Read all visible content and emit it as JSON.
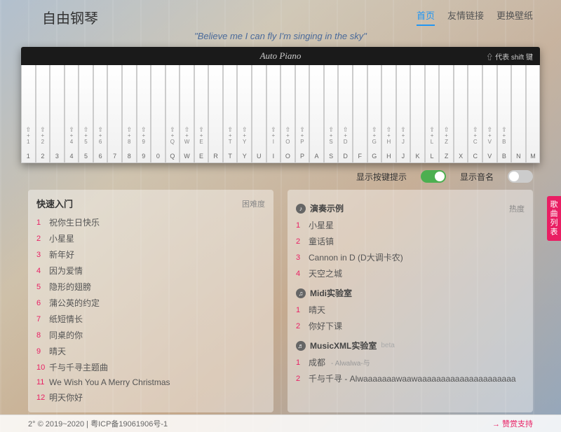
{
  "header": {
    "logo": "自由钢琴",
    "nav": [
      {
        "label": "首页",
        "active": true
      },
      {
        "label": "友情链接",
        "active": false
      },
      {
        "label": "更换壁纸",
        "active": false
      }
    ],
    "tagline": "\"Believe me I can fly I'm singing in the sky\""
  },
  "piano": {
    "brand": "Auto Piano",
    "hint": "⇧ 代表 shift 键",
    "white_keys": [
      "1",
      "2",
      "3",
      "4",
      "5",
      "6",
      "7",
      "8",
      "9",
      "0",
      "Q",
      "W",
      "E",
      "R",
      "T",
      "Y",
      "U",
      "I",
      "O",
      "P",
      "A",
      "S",
      "D",
      "F",
      "G",
      "H",
      "J",
      "K",
      "L",
      "Z",
      "X",
      "C",
      "V",
      "B",
      "N",
      "M"
    ],
    "shift_labels": [
      "1",
      "2",
      "",
      "4",
      "5",
      "6",
      "",
      "8",
      "9",
      "",
      "Q",
      "W",
      "E",
      "",
      "T",
      "Y",
      "",
      "I",
      "O",
      "P",
      "",
      "S",
      "D",
      "",
      "G",
      "H",
      "J",
      "",
      "L",
      "Z",
      "",
      "C",
      "V",
      "B",
      "",
      ""
    ]
  },
  "controls": {
    "show_keys": {
      "label": "显示按键提示",
      "on": true
    },
    "show_notes": {
      "label": "显示音名",
      "on": false
    }
  },
  "left_panel": {
    "title": "快速入门",
    "sub": "困难度",
    "songs": [
      {
        "n": "1",
        "t": "祝你生日快乐"
      },
      {
        "n": "2",
        "t": "小星星"
      },
      {
        "n": "3",
        "t": "新年好"
      },
      {
        "n": "4",
        "t": "因为爱情"
      },
      {
        "n": "5",
        "t": "隐形的翅膀"
      },
      {
        "n": "6",
        "t": "蒲公英的约定"
      },
      {
        "n": "7",
        "t": "纸短情长"
      },
      {
        "n": "8",
        "t": "同桌的你"
      },
      {
        "n": "9",
        "t": "晴天"
      },
      {
        "n": "10",
        "t": "千与千寻主题曲"
      },
      {
        "n": "11",
        "t": "We Wish You A Merry Christmas"
      },
      {
        "n": "12",
        "t": "明天你好"
      }
    ]
  },
  "right_panel": {
    "sections": [
      {
        "icon": "♪",
        "title": "演奏示例",
        "heat": "热度",
        "songs": [
          {
            "n": "1",
            "t": "小星星"
          },
          {
            "n": "2",
            "t": "童话镇"
          },
          {
            "n": "3",
            "t": "Cannon in D (D大调卡农)"
          },
          {
            "n": "4",
            "t": "天空之城"
          }
        ]
      },
      {
        "icon": "♫",
        "title": "Midi实验室",
        "songs": [
          {
            "n": "1",
            "t": "晴天"
          },
          {
            "n": "2",
            "t": "你好下课"
          }
        ]
      },
      {
        "icon": "♬",
        "title": "MusicXML实验室",
        "beta": "beta",
        "songs": [
          {
            "n": "1",
            "t": "成都",
            "extra": "- Alwalwa-与"
          },
          {
            "n": "2",
            "t": "千与千寻 - Alwaaaaaaawaawaaaaaaaaaaaaaaaaaaaaa"
          }
        ]
      }
    ]
  },
  "side_tab": "歌曲列表",
  "footer": {
    "copyright": "2° © 2019~2020  |  粤ICP备19061906号-1",
    "sponsor": "→ 赞赏支持"
  }
}
